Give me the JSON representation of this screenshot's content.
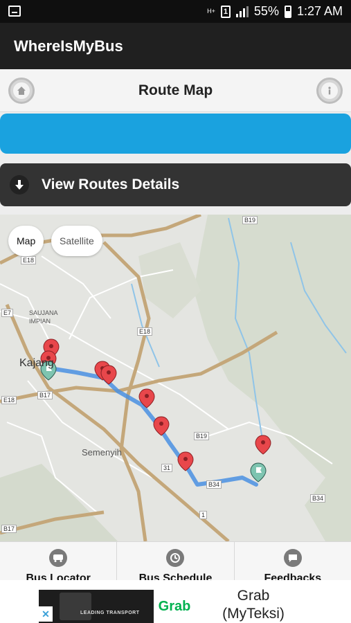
{
  "status_bar": {
    "network_label": "H+",
    "sim_label": "1",
    "battery_text": "55%",
    "time": "1:27 AM"
  },
  "app_bar": {
    "title": "WhereIsMyBus"
  },
  "page_header": {
    "title": "Route Map",
    "left_icon": "home-icon",
    "right_icon": "info-icon"
  },
  "routes_bar": {
    "label": "View Routes Details",
    "icon": "arrow-down-icon"
  },
  "map": {
    "toggle_map": "Map",
    "toggle_satellite": "Satellite",
    "place_kajang": "Kajang",
    "place_semenyih": "Semenyih",
    "place_saujana": "SAUJANA IMPIAN",
    "road_labels": [
      "B19",
      "E18",
      "E7",
      "E18",
      "B17",
      "E18",
      "B19",
      "31",
      "B34",
      "1",
      "B34",
      "B17"
    ],
    "route_color": "#4a90e2",
    "pin_color": "#e8474b"
  },
  "bottom_nav": [
    {
      "label": "Bus Locator",
      "icon": "bus-icon"
    },
    {
      "label": "Bus Schedule",
      "icon": "clock-icon"
    },
    {
      "label": "Feedbacks",
      "icon": "chat-icon"
    }
  ],
  "ad": {
    "banner_text": "LEADING TRANSPORT",
    "brand": "Grab",
    "title_line1": "Grab",
    "title_line2": "(MyTeksi)",
    "close_label": "✕"
  }
}
